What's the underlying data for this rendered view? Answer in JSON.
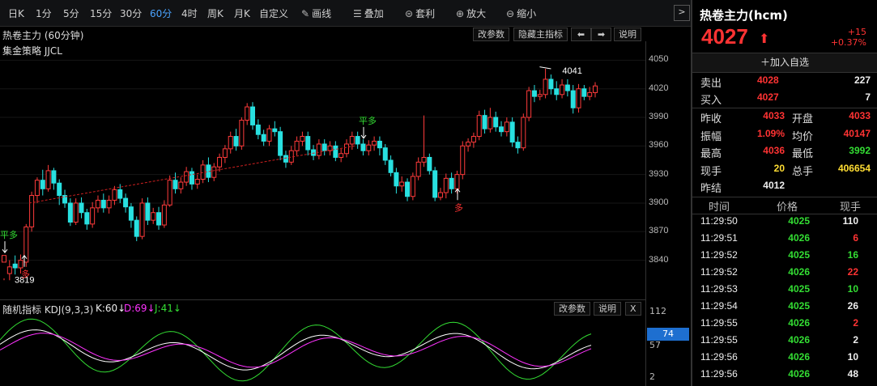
{
  "toolbar": {
    "periods": [
      {
        "label": "日K",
        "active": false
      },
      {
        "label": "1分",
        "active": false
      },
      {
        "label": "5分",
        "active": false
      },
      {
        "label": "15分",
        "active": false
      },
      {
        "label": "30分",
        "active": false
      },
      {
        "label": "60分",
        "active": true
      },
      {
        "label": "4时",
        "active": false
      },
      {
        "label": "周K",
        "active": false
      },
      {
        "label": "月K",
        "active": false
      },
      {
        "label": "自定义",
        "active": false
      }
    ],
    "tools": {
      "draw": "画线",
      "overlay": "叠加",
      "arbitrage": "套利",
      "zoom_in": "放大",
      "zoom_out": "缩小"
    },
    "more_icon": "chevron-right-icon"
  },
  "chart_header": {
    "title": "热卷主力 (60分钟)",
    "strategy": "集金策略 JJCL",
    "edit_params": "改参数",
    "hide_indicator": "隐藏主指标",
    "explain": "说明"
  },
  "indicator_header": {
    "name": "随机指标 KDJ(9,3,3)",
    "k_label": "K:60↓",
    "d_label": "D:69↓",
    "j_label": "J:41↓",
    "edit_params": "改参数",
    "explain": "说明",
    "close": "X",
    "current_value": "74"
  },
  "chart_data": {
    "type": "candlestick",
    "y_ticks": [
      "4050",
      "4020",
      "3990",
      "3960",
      "3930",
      "3900",
      "3870",
      "3840"
    ],
    "ylim": [
      3815,
      4058
    ],
    "high_label": "4041",
    "low_label": "3819",
    "signals": [
      {
        "text": "平多",
        "color": "#33dd33"
      },
      {
        "text": "多",
        "color": "#ff3333"
      },
      {
        "text": "平多",
        "color": "#33dd33"
      },
      {
        "text": "多",
        "color": "#ff3333"
      }
    ],
    "candles": [
      [
        3838,
        3845,
        3821,
        3819
      ],
      [
        3826,
        3833,
        3840,
        3819
      ],
      [
        3836,
        3832,
        3845,
        3825
      ],
      [
        3832,
        3840,
        3846,
        3826
      ],
      [
        3838,
        3875,
        3878,
        3833
      ],
      [
        3875,
        3908,
        3912,
        3870
      ],
      [
        3908,
        3924,
        3927,
        3900
      ],
      [
        3924,
        3915,
        3935,
        3908
      ],
      [
        3915,
        3934,
        3940,
        3912
      ],
      [
        3934,
        3921,
        3937,
        3914
      ],
      [
        3921,
        3908,
        3925,
        3898
      ],
      [
        3908,
        3900,
        3914,
        3895
      ],
      [
        3900,
        3880,
        3905,
        3876
      ],
      [
        3880,
        3900,
        3905,
        3877
      ],
      [
        3900,
        3890,
        3906,
        3884
      ],
      [
        3890,
        3878,
        3894,
        3872
      ],
      [
        3878,
        3895,
        3901,
        3874
      ],
      [
        3895,
        3903,
        3908,
        3890
      ],
      [
        3903,
        3895,
        3910,
        3890
      ],
      [
        3895,
        3903,
        3908,
        3889
      ],
      [
        3903,
        3914,
        3918,
        3898
      ],
      [
        3914,
        3905,
        3920,
        3900
      ],
      [
        3905,
        3896,
        3910,
        3890
      ],
      [
        3896,
        3882,
        3900,
        3874
      ],
      [
        3882,
        3865,
        3886,
        3860
      ],
      [
        3865,
        3900,
        3905,
        3862
      ],
      [
        3900,
        3882,
        3906,
        3877
      ],
      [
        3882,
        3890,
        3895,
        3878
      ],
      [
        3890,
        3877,
        3896,
        3872
      ],
      [
        3877,
        3898,
        3903,
        3874
      ],
      [
        3898,
        3924,
        3929,
        3896
      ],
      [
        3924,
        3915,
        3932,
        3910
      ],
      [
        3915,
        3922,
        3927,
        3910
      ],
      [
        3922,
        3933,
        3938,
        3918
      ],
      [
        3933,
        3920,
        3937,
        3914
      ],
      [
        3920,
        3925,
        3930,
        3915
      ],
      [
        3925,
        3940,
        3945,
        3921
      ],
      [
        3940,
        3927,
        3948,
        3922
      ],
      [
        3927,
        3938,
        3942,
        3923
      ],
      [
        3938,
        3948,
        3952,
        3933
      ],
      [
        3948,
        3957,
        3961,
        3942
      ],
      [
        3957,
        3970,
        3975,
        3952
      ],
      [
        3970,
        3960,
        3978,
        3955
      ],
      [
        3960,
        3987,
        3990,
        3956
      ],
      [
        3987,
        4001,
        4005,
        3982
      ],
      [
        4001,
        3982,
        4006,
        3977
      ],
      [
        3982,
        3972,
        3988,
        3967
      ],
      [
        3972,
        3965,
        3977,
        3960
      ],
      [
        3965,
        3978,
        3982,
        3960
      ],
      [
        3978,
        3975,
        3986,
        3970
      ],
      [
        3975,
        3950,
        3980,
        3945
      ],
      [
        3950,
        3943,
        3955,
        3937
      ],
      [
        3943,
        3955,
        3960,
        3940
      ],
      [
        3955,
        3965,
        3970,
        3950
      ],
      [
        3965,
        3970,
        3975,
        3960
      ],
      [
        3970,
        3956,
        3975,
        3950
      ],
      [
        3956,
        3950,
        3961,
        3945
      ],
      [
        3950,
        3962,
        3967,
        3946
      ],
      [
        3962,
        3955,
        3967,
        3950
      ],
      [
        3955,
        3960,
        3965,
        3950
      ],
      [
        3960,
        3948,
        3965,
        3944
      ],
      [
        3948,
        3952,
        3957,
        3943
      ],
      [
        3952,
        3962,
        3967,
        3948
      ],
      [
        3962,
        3970,
        3975,
        3956
      ],
      [
        3970,
        3962,
        3975,
        3957
      ],
      [
        3962,
        3955,
        3967,
        3950
      ],
      [
        3955,
        3961,
        3966,
        3950
      ],
      [
        3961,
        3965,
        3970,
        3955
      ],
      [
        3965,
        3958,
        3970,
        3950
      ],
      [
        3958,
        3945,
        3962,
        3940
      ],
      [
        3945,
        3932,
        3950,
        3928
      ],
      [
        3932,
        3918,
        3937,
        3910
      ],
      [
        3918,
        3922,
        3928,
        3912
      ],
      [
        3922,
        3907,
        3926,
        3902
      ],
      [
        3907,
        3928,
        3932,
        3903
      ],
      [
        3928,
        3943,
        3948,
        3924
      ],
      [
        3943,
        3948,
        3992,
        3938
      ],
      [
        3948,
        3934,
        3952,
        3930
      ],
      [
        3934,
        3906,
        3938,
        3902
      ],
      [
        3906,
        3911,
        3916,
        3903
      ],
      [
        3911,
        3926,
        3931,
        3905
      ],
      [
        3926,
        3915,
        3932,
        3910
      ],
      [
        3915,
        3930,
        3934,
        3910
      ],
      [
        3930,
        3960,
        3965,
        3925
      ],
      [
        3960,
        3964,
        3968,
        3954
      ],
      [
        3964,
        3970,
        3974,
        3958
      ],
      [
        3970,
        3992,
        3997,
        3966
      ],
      [
        3992,
        3978,
        3998,
        3973
      ],
      [
        3978,
        3990,
        4000,
        3974
      ],
      [
        3990,
        3980,
        3996,
        3975
      ],
      [
        3980,
        3975,
        3986,
        3970
      ],
      [
        3975,
        3985,
        3990,
        3970
      ],
      [
        3985,
        3964,
        3990,
        3959
      ],
      [
        3964,
        3958,
        3970,
        3952
      ],
      [
        3958,
        3990,
        3994,
        3955
      ],
      [
        3990,
        4018,
        4022,
        3986
      ],
      [
        4018,
        4012,
        4024,
        4006
      ],
      [
        4012,
        4014,
        4019,
        4008
      ],
      [
        4014,
        4030,
        4041,
        4010
      ],
      [
        4030,
        4020,
        4035,
        4014
      ],
      [
        4020,
        4014,
        4028,
        4008
      ],
      [
        4014,
        4024,
        4030,
        4010
      ],
      [
        4024,
        4018,
        4030,
        4012
      ],
      [
        4018,
        4000,
        4024,
        3994
      ],
      [
        4000,
        4020,
        4025,
        3995
      ],
      [
        4020,
        4012,
        4024,
        4008
      ],
      [
        4012,
        4016,
        4022,
        4008
      ],
      [
        4016,
        4023,
        4027,
        4011
      ]
    ]
  },
  "quote": {
    "title": "热卷主力(hcm)",
    "price": "4027",
    "arrow": "⬆",
    "change": "+15",
    "change_pct": "+0.37%",
    "add_watch": "加入自选",
    "sell_label": "卖出",
    "sell_price": "4028",
    "sell_vol": "227",
    "buy_label": "买入",
    "buy_price": "4027",
    "buy_vol": "7",
    "stats": [
      {
        "l1": "昨收",
        "v1": "4033",
        "c1": "red",
        "l2": "开盘",
        "v2": "4033",
        "c2": "red"
      },
      {
        "l1": "振幅",
        "v1": "1.09%",
        "c1": "red",
        "l2": "均价",
        "v2": "40147",
        "c2": "red"
      },
      {
        "l1": "最高",
        "v1": "4036",
        "c1": "red",
        "l2": "最低",
        "v2": "3992",
        "c2": "green"
      },
      {
        "l1": "现手",
        "v1": "20",
        "c1": "yellow",
        "l2": "总手",
        "v2": "406654",
        "c2": "yellow"
      },
      {
        "l1": "昨结",
        "v1": "4012",
        "c1": "white",
        "l2": "",
        "v2": "",
        "c2": "white"
      }
    ],
    "ticks_header": {
      "time": "时间",
      "price": "价格",
      "volume": "现手"
    },
    "ticks": [
      {
        "time": "11:29:50",
        "price": "4025",
        "volume": "110",
        "vcolor": "white"
      },
      {
        "time": "11:29:51",
        "price": "4026",
        "volume": "6",
        "vcolor": "red"
      },
      {
        "time": "11:29:52",
        "price": "4025",
        "volume": "16",
        "vcolor": "green"
      },
      {
        "time": "11:29:52",
        "price": "4026",
        "volume": "22",
        "vcolor": "red"
      },
      {
        "time": "11:29:53",
        "price": "4025",
        "volume": "10",
        "vcolor": "green"
      },
      {
        "time": "11:29:54",
        "price": "4025",
        "volume": "26",
        "vcolor": "white"
      },
      {
        "time": "11:29:55",
        "price": "4026",
        "volume": "2",
        "vcolor": "red"
      },
      {
        "time": "11:29:55",
        "price": "4026",
        "volume": "2",
        "vcolor": "white"
      },
      {
        "time": "11:29:56",
        "price": "4026",
        "volume": "10",
        "vcolor": "white"
      },
      {
        "time": "11:29:56",
        "price": "4026",
        "volume": "48",
        "vcolor": "white"
      }
    ]
  },
  "kdj_axis": [
    "112",
    "57",
    "2"
  ]
}
